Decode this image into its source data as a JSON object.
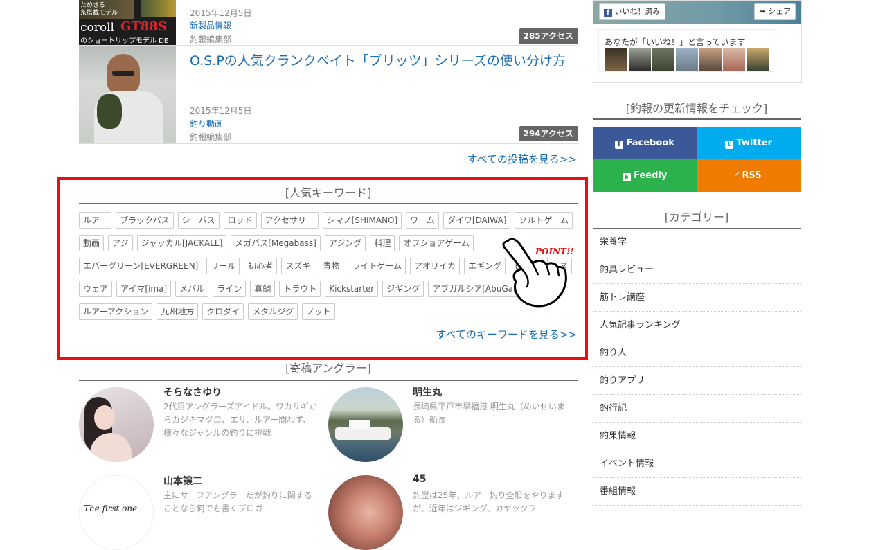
{
  "articles": [
    {
      "thumb_text_1": "ためきる",
      "thumb_text_2": "糸搭載モデル",
      "thumb_brand": "coroll",
      "thumb_model": "GT88S",
      "thumb_sub": "のショートリップモデル DE",
      "date": "2015年12月5日",
      "category": "新製品情報",
      "author": "釣報編集部",
      "access": "285アクセス"
    },
    {
      "title": "O.S.Pの人気クランクベイト「ブリッツ」シリーズの使い分け方",
      "date": "2015年12月5日",
      "category": "釣り動画",
      "author": "釣報編集部",
      "access": "294アクセス"
    }
  ],
  "all_posts_link": "すべての投稿を見る>>",
  "keywords": {
    "heading": "[人気キーワード]",
    "items": [
      "ルアー",
      "ブラックバス",
      "シーバス",
      "ロッド",
      "アクセサリー",
      "シマノ[SHIMANO]",
      "ワーム",
      "ダイワ[DAIWA]",
      "ソルトゲーム",
      "動画",
      "アジ",
      "ジャッカル[JACKALL]",
      "メガバス[Megabass]",
      "アジング",
      "料理",
      "オフショアゲーム",
      "エバーグリーン[EVERGREEN]",
      "リール",
      "初心者",
      "スズキ",
      "青物",
      "ライトゲーム",
      "アオリイカ",
      "エギング",
      "ヒラメ",
      "チヌ",
      "ウェア",
      "アイマ[ima]",
      "メバル",
      "ライン",
      "真鯛",
      "トラウト",
      "Kickstarter",
      "ジギング",
      "アブガルシア[AbuGarcia]",
      "ルアーアクション",
      "九州地方",
      "クロダイ",
      "メタルジグ",
      "ノット"
    ],
    "all_link": "すべてのキーワードを見る>>",
    "point_label": "POINT!!"
  },
  "anglers": {
    "heading": "[寄稿アングラー]",
    "items": [
      {
        "name": "そらなさゆり",
        "desc": "2代目アングラーズアイドル。ワカサギからカジキマグロ、エサ、ルアー問わず、様々なジャンルの釣りに挑戦"
      },
      {
        "name": "明生丸",
        "desc": "長崎県平戸市早福港 明生丸（めいせいまる）船長"
      },
      {
        "name": "山本譲二",
        "desc": "主にサーフアングラーだが釣りに関することなら何でも書くブロガー",
        "thumb_text": "The first one"
      },
      {
        "name": "45",
        "desc": "釣歴は25年、ルアー釣り全般をやりますが、近年はジギング、カヤックフ"
      }
    ]
  },
  "facebook": {
    "like_label": "いいね！済み",
    "share_label": "シェア",
    "friends_text": "あなたが「いいね！」と言っています"
  },
  "follow": {
    "heading": "[釣報の更新情報をチェック]",
    "buttons": [
      {
        "label": "Facebook",
        "icon": "facebook-icon",
        "color": "#3b5998"
      },
      {
        "label": "Twitter",
        "icon": "twitter-icon",
        "color": "#00aced"
      },
      {
        "label": "Feedly",
        "icon": "feedly-icon",
        "color": "#2bb24c"
      },
      {
        "label": "RSS",
        "icon": "rss-icon",
        "color": "#ef7c00"
      }
    ]
  },
  "categories": {
    "heading": "[カテゴリー]",
    "items": [
      "栄養学",
      "釣具レビュー",
      "筋トレ講座",
      "人気記事ランキング",
      "釣り人",
      "釣りアプリ",
      "釣行記",
      "釣果情報",
      "イベント情報",
      "番組情報"
    ]
  }
}
